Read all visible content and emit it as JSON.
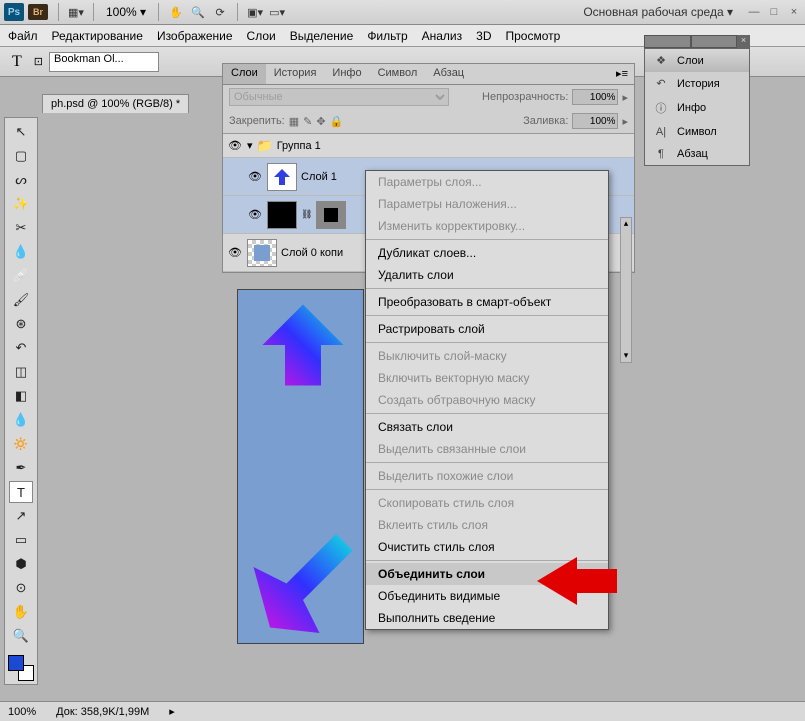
{
  "topbar": {
    "ps": "Ps",
    "br": "Br",
    "zoom": "100% ▾",
    "workspace": "Основная рабочая среда ▾"
  },
  "menu": [
    "Файл",
    "Редактирование",
    "Изображение",
    "Слои",
    "Выделение",
    "Фильтр",
    "Анализ",
    "3D",
    "Просмотр"
  ],
  "options": {
    "font": "Bookman Ol..."
  },
  "doc_tab": "ph.psd @ 100% (RGB/8) *",
  "panel_tabs": [
    "Слои",
    "История",
    "Инфо",
    "Символ",
    "Абзац"
  ],
  "panel": {
    "mode_placeholder": "Обычные",
    "opacity_label": "Непрозрачность:",
    "opacity_val": "100%",
    "lock_label": "Закрепить:",
    "fill_label": "Заливка:",
    "fill_val": "100%"
  },
  "layers": {
    "group": "Группа 1",
    "layer1": "Слой 1",
    "copy": "Слой 0 копи"
  },
  "context_menu": [
    {
      "t": "Параметры слоя...",
      "dis": true
    },
    {
      "t": "Параметры наложения...",
      "dis": true
    },
    {
      "t": "Изменить корректировку...",
      "dis": true
    },
    {
      "sep": true
    },
    {
      "t": "Дубликат слоев..."
    },
    {
      "t": "Удалить слои"
    },
    {
      "sep": true
    },
    {
      "t": "Преобразовать в смарт-объект"
    },
    {
      "sep": true
    },
    {
      "t": "Растрировать слой"
    },
    {
      "sep": true
    },
    {
      "t": "Выключить слой-маску",
      "dis": true
    },
    {
      "t": "Включить векторную маску",
      "dis": true
    },
    {
      "t": "Создать обтравочную маску",
      "dis": true
    },
    {
      "sep": true
    },
    {
      "t": "Связать слои"
    },
    {
      "t": "Выделить связанные слои",
      "dis": true
    },
    {
      "sep": true
    },
    {
      "t": "Выделить похожие слои",
      "dis": true
    },
    {
      "sep": true
    },
    {
      "t": "Скопировать стиль слоя",
      "dis": true
    },
    {
      "t": "Вклеить стиль слоя",
      "dis": true
    },
    {
      "t": "Очистить стиль слоя"
    },
    {
      "sep": true
    },
    {
      "t": "Объединить слои",
      "hl": true
    },
    {
      "t": "Объединить видимые"
    },
    {
      "t": "Выполнить сведение"
    }
  ],
  "flyout": [
    "Слои",
    "История",
    "Инфо",
    "Символ",
    "Абзац"
  ],
  "status": {
    "zoom": "100%",
    "doc": "Док: 358,9K/1,99M"
  }
}
